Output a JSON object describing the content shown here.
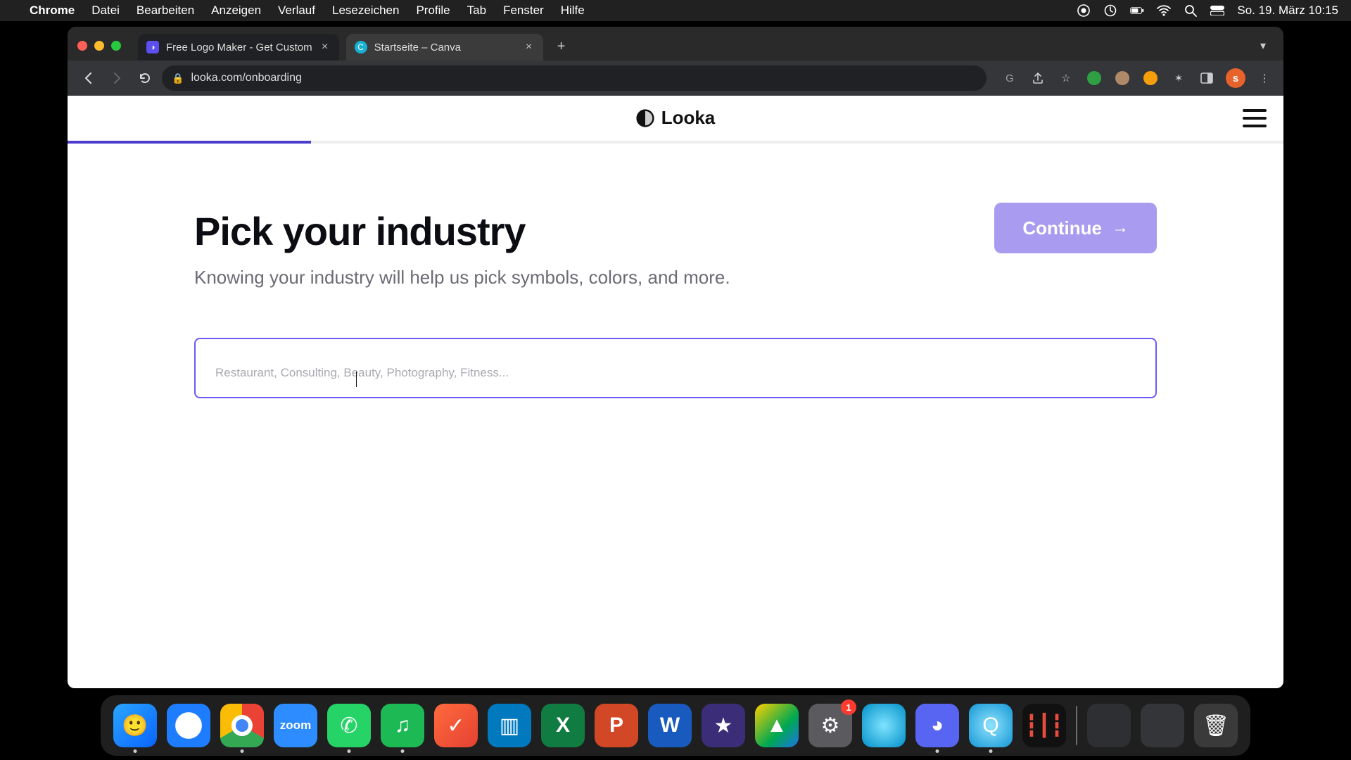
{
  "menubar": {
    "app": "Chrome",
    "items": [
      "Datei",
      "Bearbeiten",
      "Anzeigen",
      "Verlauf",
      "Lesezeichen",
      "Profile",
      "Tab",
      "Fenster",
      "Hilfe"
    ],
    "clock": "So. 19. März  10:15"
  },
  "tabs": {
    "active": {
      "title": "Free Logo Maker - Get Custom",
      "favicon_bg": "#5b4ff0"
    },
    "other": {
      "title": "Startseite – Canva",
      "favicon_bg": "#17b1d1"
    }
  },
  "addr": {
    "url_display": "looka.com/onboarding"
  },
  "avatar_letter": "s",
  "page": {
    "brand": "Looka",
    "progress_percent": 20,
    "heading": "Pick your industry",
    "subhead": "Knowing your industry will help us pick symbols, colors, and more.",
    "continue_label": "Continue",
    "input_placeholder": "Restaurant, Consulting, Beauty, Photography, Fitness...",
    "input_value": ""
  },
  "dock": {
    "apps": [
      "Finder",
      "Safari",
      "Chrome",
      "Zoom",
      "WhatsApp",
      "Spotify",
      "Todoist",
      "Trello",
      "Excel",
      "PowerPoint",
      "Word",
      "iMovie",
      "Drive",
      "Settings",
      "BlueApp",
      "Discord",
      "QuickTime",
      "AudioApp"
    ],
    "settings_badge": "1"
  }
}
